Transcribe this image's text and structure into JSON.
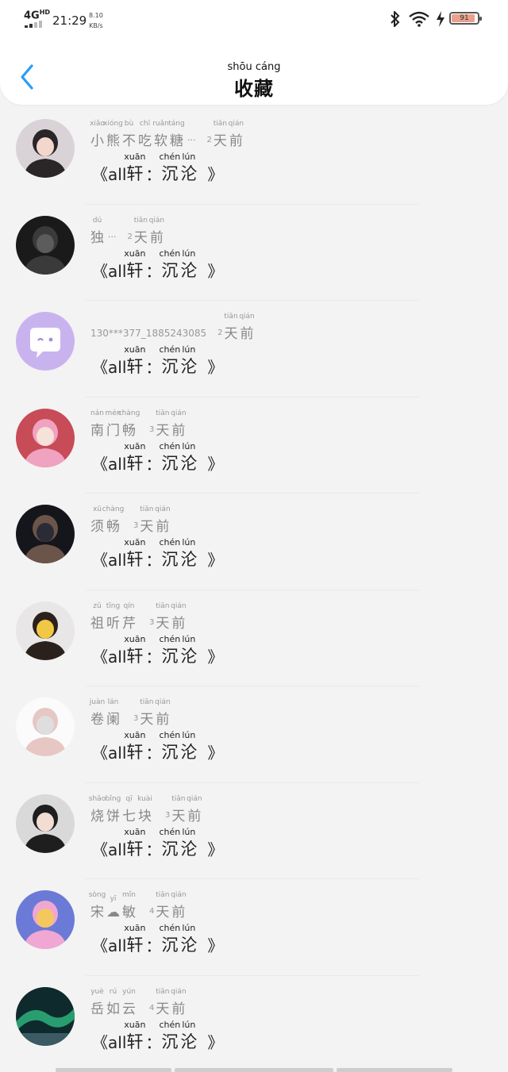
{
  "status_bar": {
    "network": "4G",
    "network_sup": "HD",
    "time": "21:29",
    "speed_value": "8.10",
    "speed_unit": "KB/s",
    "battery_level": "91",
    "battery_fraction": 0.91
  },
  "header": {
    "title_pinyin": "shōu cáng",
    "title": "收藏"
  },
  "work_title": {
    "open": "《",
    "latin": "all",
    "c1": {
      "py": "xuān",
      "ch": "轩"
    },
    "colon": "：",
    "c2": {
      "py": "chén",
      "ch": "沉"
    },
    "c3": {
      "py": "lún",
      "ch": "沦"
    },
    "close": "》"
  },
  "items": [
    {
      "user": [
        {
          "py": "xiǎo",
          "ch": "小"
        },
        {
          "py": "xióng",
          "ch": "熊"
        },
        {
          "py": "bù",
          "ch": "不"
        },
        {
          "py": "chī",
          "ch": "吃"
        },
        {
          "py": "ruǎn",
          "ch": "软"
        },
        {
          "py": "táng",
          "ch": "糖"
        }
      ],
      "user_latin": "",
      "ellipsis": "···",
      "days": "2",
      "avatar_colors": [
        "#d9d3d8",
        "#2a2526",
        "#f3d6cc"
      ]
    },
    {
      "user": [
        {
          "py": "dú",
          "ch": "独"
        }
      ],
      "user_latin": "",
      "ellipsis": "···",
      "days": "2",
      "avatar_colors": [
        "#1a1a1a",
        "#3a3a3a",
        "#5c5c5c"
      ]
    },
    {
      "user": [],
      "user_latin": "130***377_1885243085",
      "ellipsis": "",
      "days": "2",
      "avatar_colors": [
        "#c9b3ef",
        "#ffffff",
        "#a88bd9"
      ]
    },
    {
      "user": [
        {
          "py": "nán",
          "ch": "南"
        },
        {
          "py": "mén",
          "ch": "门"
        },
        {
          "py": "chàng",
          "ch": "畅"
        }
      ],
      "user_latin": "",
      "ellipsis": "",
      "days": "3",
      "avatar_colors": [
        "#c84b58",
        "#f0a3c0",
        "#f6e2d8"
      ]
    },
    {
      "user": [
        {
          "py": "xū",
          "ch": "须"
        },
        {
          "py": "chàng",
          "ch": "畅"
        }
      ],
      "user_latin": "",
      "ellipsis": "",
      "days": "3",
      "avatar_colors": [
        "#15151c",
        "#6b5449",
        "#2b2b36"
      ]
    },
    {
      "user": [
        {
          "py": "zǔ",
          "ch": "祖"
        },
        {
          "py": "tīng",
          "ch": "听"
        },
        {
          "py": "qín",
          "ch": "芹"
        }
      ],
      "user_latin": "",
      "ellipsis": "",
      "days": "3",
      "avatar_colors": [
        "#e8e6e6",
        "#2a211c",
        "#f1c845"
      ]
    },
    {
      "user": [
        {
          "py": "juàn",
          "ch": "卷"
        },
        {
          "py": "lán",
          "ch": "阑"
        }
      ],
      "user_latin": "",
      "ellipsis": "",
      "days": "3",
      "avatar_colors": [
        "#fbfbfb",
        "#e6c7c3",
        "#dedede"
      ]
    },
    {
      "user": [
        {
          "py": "shāo",
          "ch": "烧"
        },
        {
          "py": "bǐng",
          "ch": "饼"
        },
        {
          "py": "qī",
          "ch": "七"
        },
        {
          "py": "kuài",
          "ch": "块"
        }
      ],
      "user_latin": "",
      "ellipsis": "",
      "days": "3",
      "avatar_colors": [
        "#d9d9d9",
        "#1e1e1e",
        "#f2ddd2"
      ]
    },
    {
      "user": [
        {
          "py": "sòng",
          "ch": "宋"
        },
        {
          "py": "yī",
          "ch": "☁"
        },
        {
          "py": "mǐn",
          "ch": "敏"
        }
      ],
      "user_latin": "",
      "ellipsis": "",
      "days": "4",
      "avatar_colors": [
        "#6b7ad6",
        "#f0a7d4",
        "#f4c85e"
      ]
    },
    {
      "user": [
        {
          "py": "yuè",
          "ch": "岳"
        },
        {
          "py": "rú",
          "ch": "如"
        },
        {
          "py": "yún",
          "ch": "云"
        }
      ],
      "user_latin": "",
      "ellipsis": "",
      "days": "4",
      "avatar_colors": [
        "#0f2a2c",
        "#2db27c",
        "#3b5a63"
      ]
    }
  ],
  "days_ago": {
    "tian": {
      "py": "tiān",
      "ch": "天"
    },
    "qian": {
      "py": "qián",
      "ch": "前"
    }
  },
  "icons": {
    "back": "chevron-left-icon",
    "bluetooth": "bluetooth-icon",
    "wifi": "wifi-icon",
    "charging": "charging-bolt-icon",
    "battery": "battery-icon"
  },
  "accent_color": "#2a9df4"
}
